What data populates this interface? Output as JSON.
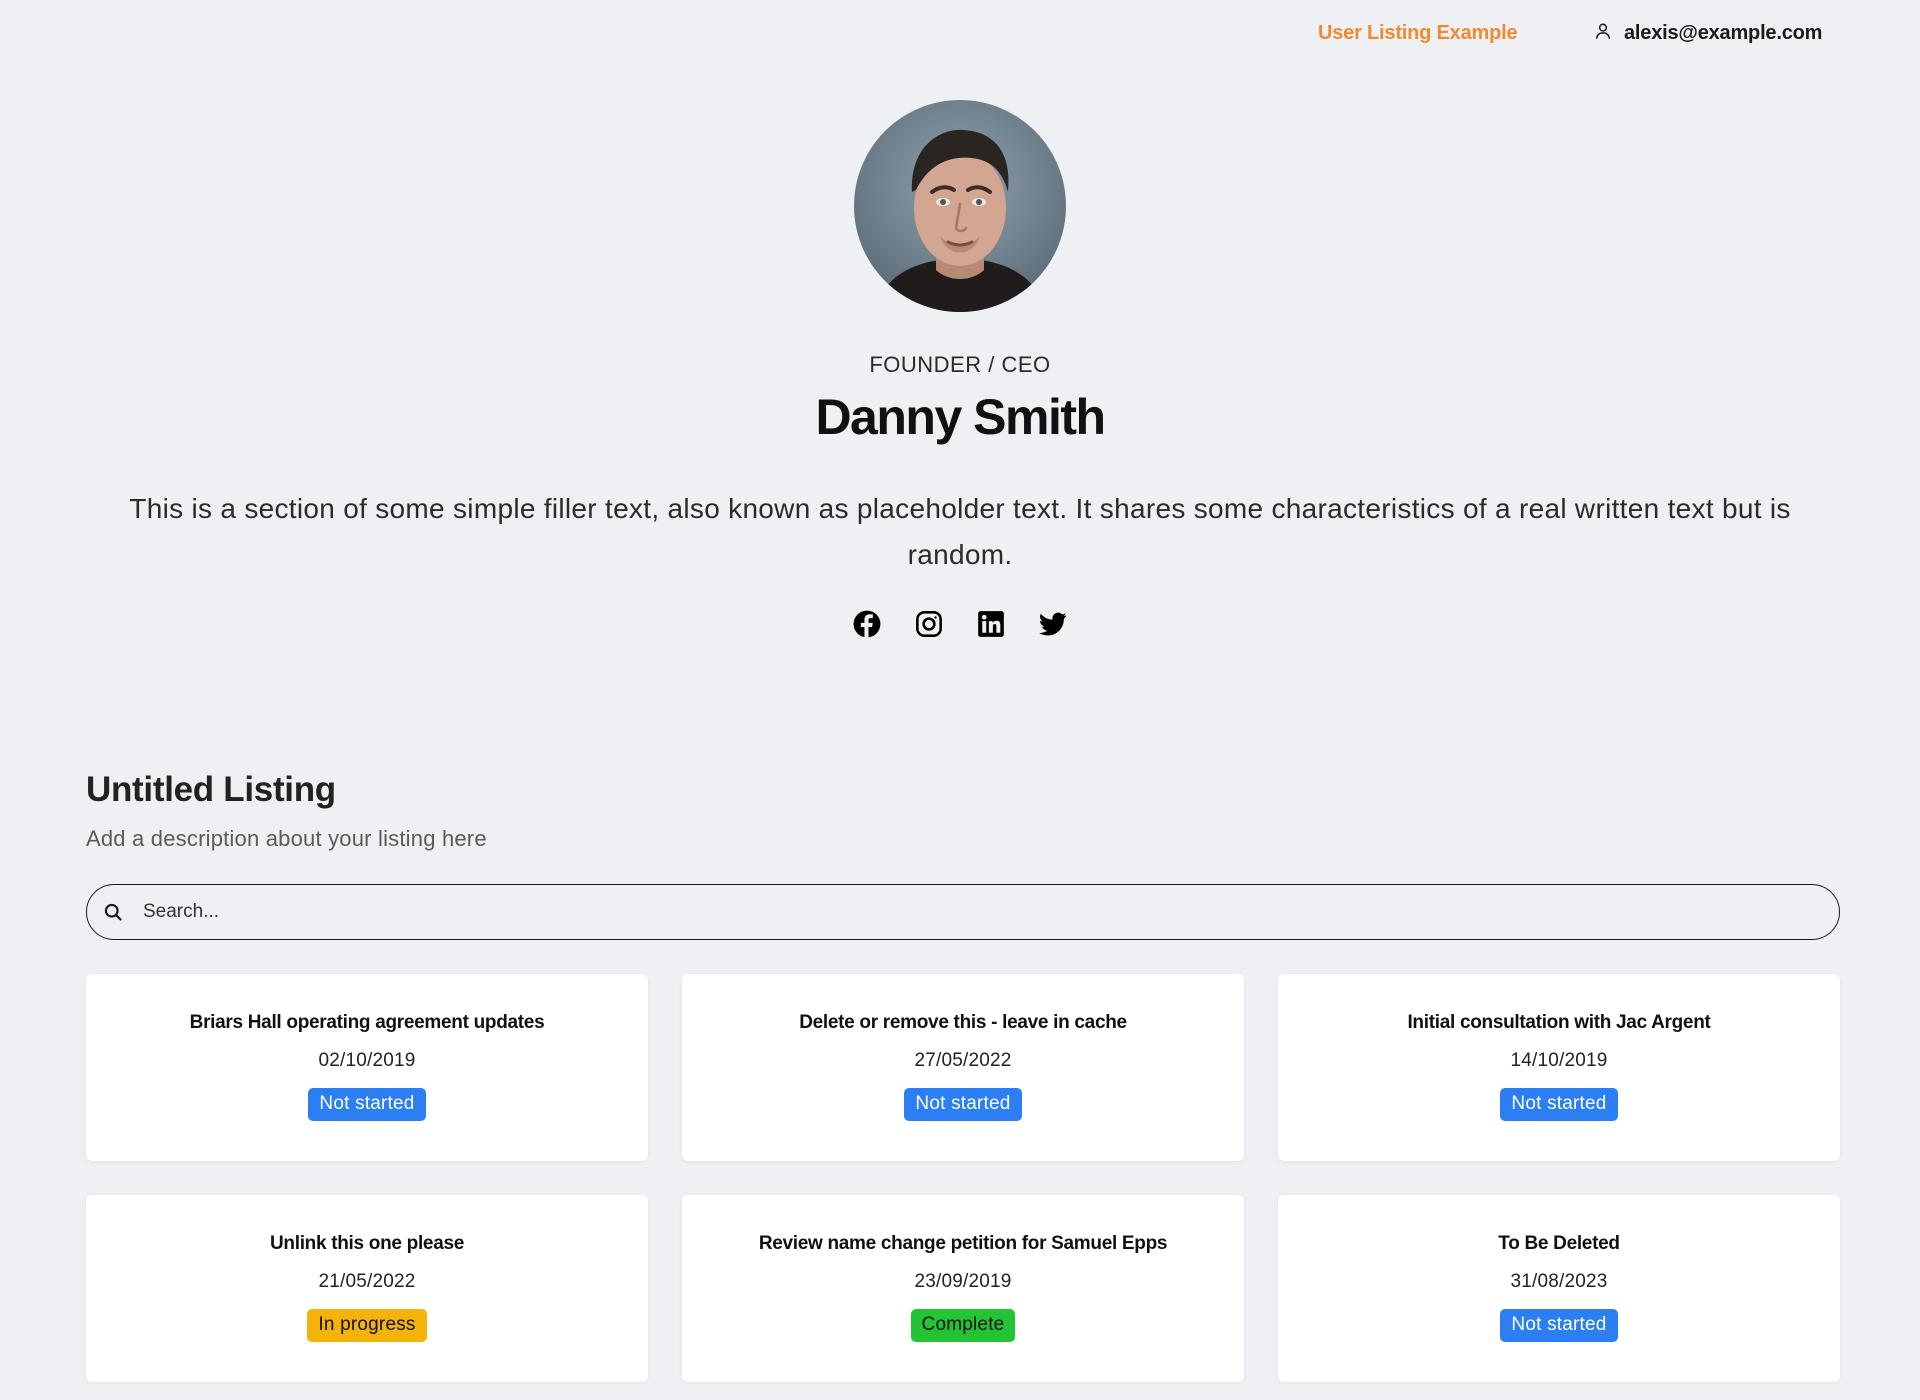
{
  "header": {
    "nav_link": "User Listing Example",
    "user_email": "alexis@example.com",
    "user_icon": "user-icon"
  },
  "profile": {
    "role": "FOUNDER / CEO",
    "name": "Danny Smith",
    "bio": "This is a section of some simple filler text, also known as placeholder text. It shares some characteristics of a real written text but is random.",
    "socials": [
      "facebook-icon",
      "instagram-icon",
      "linkedin-icon",
      "twitter-icon"
    ]
  },
  "listing": {
    "title": "Untitled Listing",
    "description": "Add a description about your listing here",
    "search_placeholder": "Search...",
    "search_icon": "search-icon",
    "items": [
      {
        "title": "Briars Hall operating agreement updates",
        "date": "02/10/2019",
        "status": "Not started"
      },
      {
        "title": "Delete or remove this - leave in cache",
        "date": "27/05/2022",
        "status": "Not started"
      },
      {
        "title": "Initial consultation with Jac Argent",
        "date": "14/10/2019",
        "status": "Not started"
      },
      {
        "title": "Unlink this one please",
        "date": "21/05/2022",
        "status": "In progress"
      },
      {
        "title": "Review name change petition for Samuel Epps",
        "date": "23/09/2019",
        "status": "Complete"
      },
      {
        "title": "To Be Deleted",
        "date": "31/08/2023",
        "status": "Not started"
      }
    ]
  },
  "colors": {
    "page_background": "#eef0f4",
    "nav_link": "#f08a2e",
    "status": {
      "Not started": {
        "bg": "#2b7ff2",
        "fg": "#ffffff"
      },
      "In progress": {
        "bg": "#f5b20b",
        "fg": "#111111"
      },
      "Complete": {
        "bg": "#22c433",
        "fg": "#111111"
      }
    }
  }
}
